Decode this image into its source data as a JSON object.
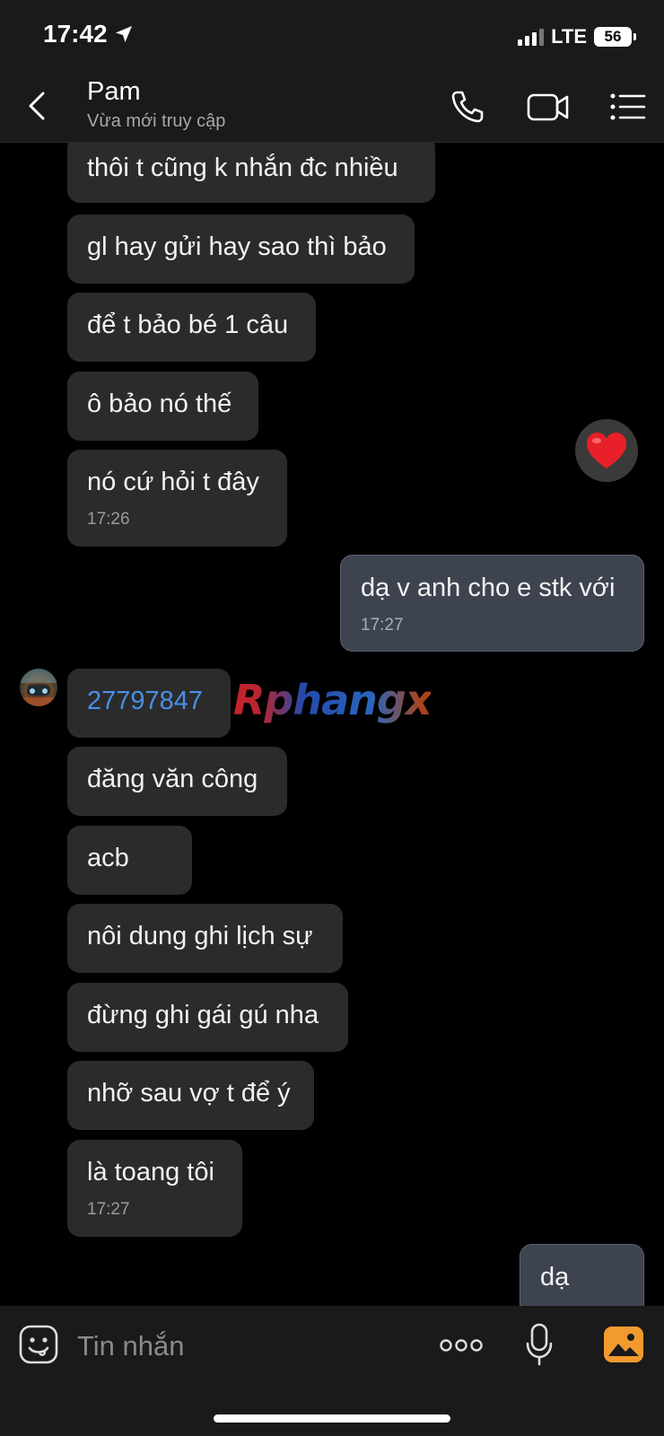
{
  "status_bar": {
    "time": "17:42",
    "network": "LTE",
    "battery": "56"
  },
  "header": {
    "contact_name": "Pam",
    "contact_status": "Vừa mới truy cập"
  },
  "messages": [
    {
      "dir": "in",
      "text": "thôi t cũng k nhắn đc nhiều"
    },
    {
      "dir": "in",
      "text": "gl hay gửi hay sao thì bảo"
    },
    {
      "dir": "in",
      "text": "để t bảo bé 1 câu"
    },
    {
      "dir": "in",
      "text": "ô bảo nó thế"
    },
    {
      "dir": "in",
      "text": "nó cứ hỏi t đây",
      "time": "17:26"
    },
    {
      "dir": "out",
      "text": "dạ v anh cho e stk với",
      "time": "17:27"
    },
    {
      "dir": "in",
      "text": "27797847",
      "link": true
    },
    {
      "dir": "in",
      "text": "đăng văn công"
    },
    {
      "dir": "in",
      "text": "acb"
    },
    {
      "dir": "in",
      "text": "nôi dung ghi lịch sự"
    },
    {
      "dir": "in",
      "text": "đừng ghi gái gú nha"
    },
    {
      "dir": "in",
      "text": "nhỡ sau vợ t để ý"
    },
    {
      "dir": "in",
      "text": "là toang tôi",
      "time": "17:27"
    },
    {
      "dir": "out",
      "text": "dạ"
    }
  ],
  "reaction": {
    "icon": "heart-icon",
    "color": "#e8202a"
  },
  "watermark": "Rphangx",
  "input": {
    "placeholder": "Tin nhắn"
  },
  "colors": {
    "incoming_bubble": "#2b2b2b",
    "outgoing_bubble": "#3e4350",
    "link": "#4a8fe9",
    "accent_gallery": "#f29a2e"
  }
}
